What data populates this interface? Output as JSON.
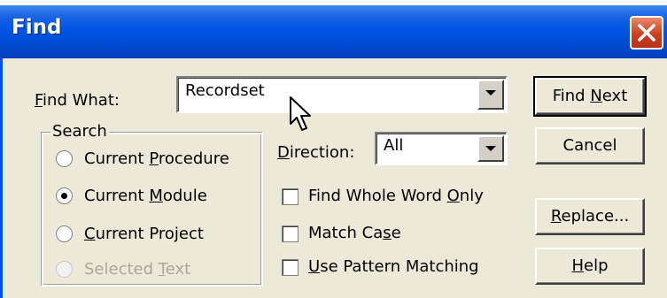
{
  "window": {
    "title": "Find",
    "close_symbol": "✕"
  },
  "find_what": {
    "label_prefix": "",
    "label_mnemonic": "F",
    "label_rest": "ind What:",
    "value": "Recordset"
  },
  "search": {
    "legend": "Search",
    "options": [
      {
        "prefix": "Current ",
        "mnemonic": "P",
        "rest": "rocedure",
        "checked": false,
        "enabled": true
      },
      {
        "prefix": "Current ",
        "mnemonic": "M",
        "rest": "odule",
        "checked": true,
        "enabled": true
      },
      {
        "prefix": "",
        "mnemonic": "C",
        "rest": "urrent Project",
        "checked": false,
        "enabled": true
      },
      {
        "prefix": "Selected ",
        "mnemonic": "T",
        "rest": "ext",
        "checked": false,
        "enabled": false
      }
    ]
  },
  "direction": {
    "label_prefix": "",
    "label_mnemonic": "D",
    "label_rest": "irection:",
    "value": "All"
  },
  "checkboxes": [
    {
      "prefix": "Find Whole Word ",
      "mnemonic": "O",
      "rest": "nly",
      "checked": false
    },
    {
      "prefix": "Match Ca",
      "mnemonic": "s",
      "rest": "e",
      "checked": false
    },
    {
      "prefix": "",
      "mnemonic": "U",
      "rest": "se Pattern Matching",
      "checked": false
    }
  ],
  "buttons": {
    "find_next": {
      "prefix": "Find ",
      "mnemonic": "N",
      "rest": "ext"
    },
    "cancel": {
      "prefix": "Cancel",
      "mnemonic": "",
      "rest": ""
    },
    "replace": {
      "prefix": "",
      "mnemonic": "R",
      "rest": "eplace..."
    },
    "help": {
      "prefix": "",
      "mnemonic": "H",
      "rest": "elp"
    }
  },
  "icons": {
    "dropdown": "chevron-down-icon",
    "cursor": "mouse-pointer-icon"
  }
}
